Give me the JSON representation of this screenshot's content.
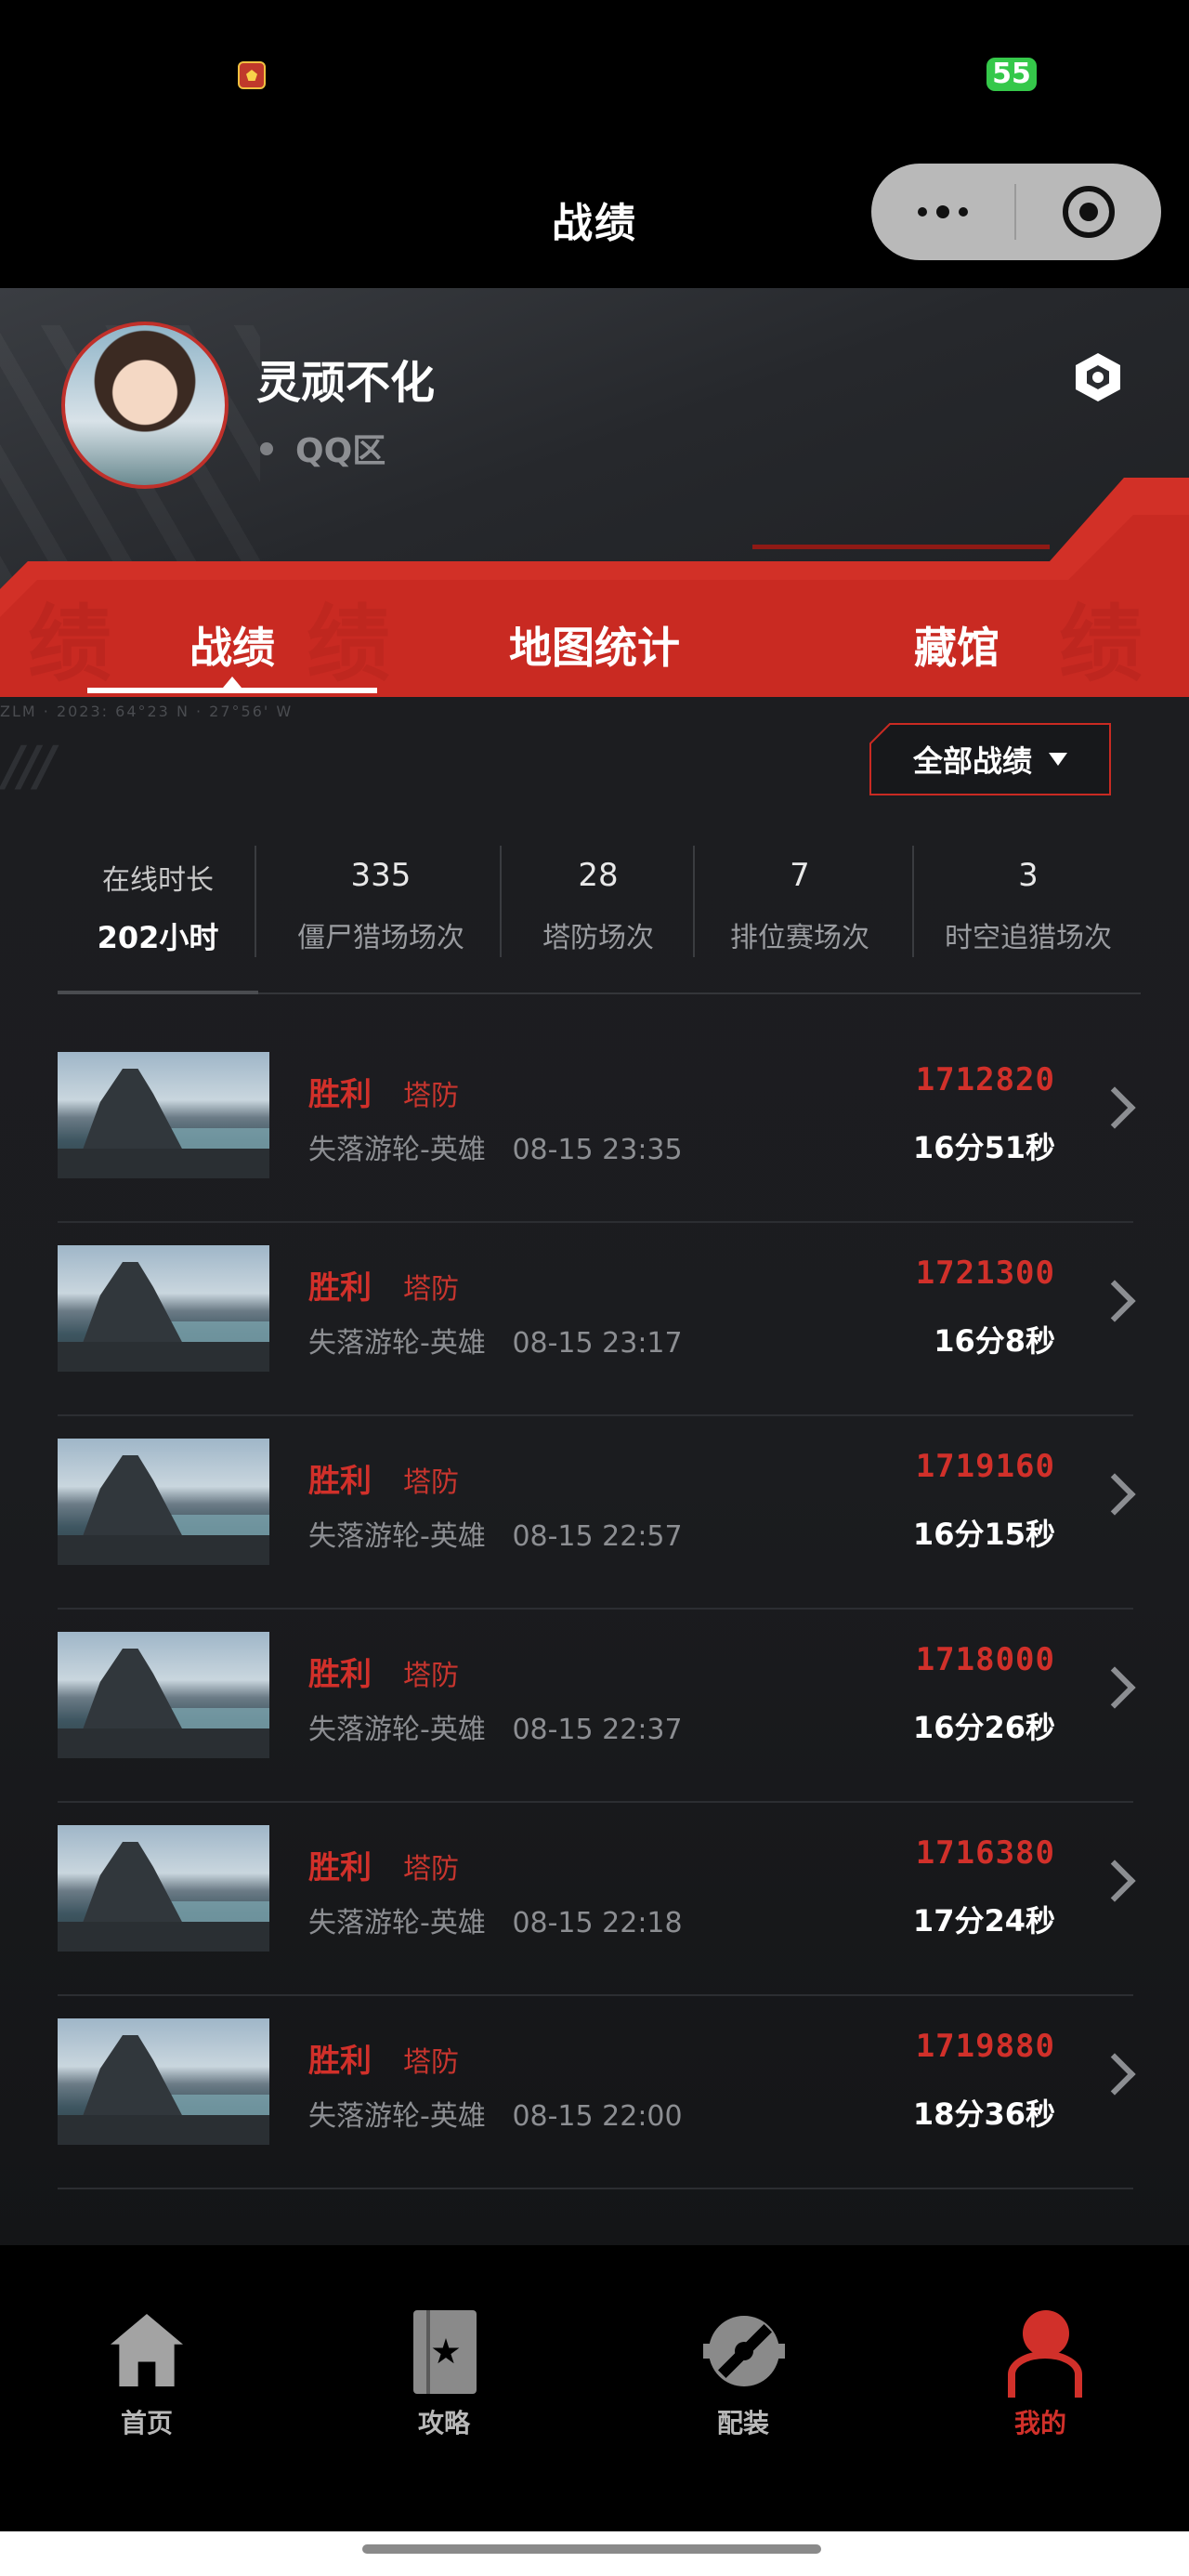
{
  "status": {
    "battery": "55"
  },
  "title": "战绩",
  "profile": {
    "name": "灵顽不化",
    "region": "QQ区"
  },
  "tabs": [
    "战绩",
    "地图统计",
    "藏馆"
  ],
  "deco": {
    "code": "ZLM · 2023: 64°23 N · 27°56' W"
  },
  "filter": {
    "label": "全部战绩"
  },
  "stats": {
    "online_label": "在线时长",
    "online_value": "202小时",
    "items": [
      {
        "value": "335",
        "label": "僵尸猎场场次"
      },
      {
        "value": "28",
        "label": "塔防场次"
      },
      {
        "value": "7",
        "label": "排位赛场次"
      },
      {
        "value": "3",
        "label": "时空追猎场次"
      }
    ]
  },
  "records": [
    {
      "result": "胜利",
      "mode": "塔防",
      "map": "失落游轮-英雄",
      "time": "08-15 23:35",
      "score": "1712820",
      "duration": "16分51秒"
    },
    {
      "result": "胜利",
      "mode": "塔防",
      "map": "失落游轮-英雄",
      "time": "08-15 23:17",
      "score": "1721300",
      "duration": "16分8秒"
    },
    {
      "result": "胜利",
      "mode": "塔防",
      "map": "失落游轮-英雄",
      "time": "08-15 22:57",
      "score": "1719160",
      "duration": "16分15秒"
    },
    {
      "result": "胜利",
      "mode": "塔防",
      "map": "失落游轮-英雄",
      "time": "08-15 22:37",
      "score": "1718000",
      "duration": "16分26秒"
    },
    {
      "result": "胜利",
      "mode": "塔防",
      "map": "失落游轮-英雄",
      "time": "08-15 22:18",
      "score": "1716380",
      "duration": "17分24秒"
    },
    {
      "result": "胜利",
      "mode": "塔防",
      "map": "失落游轮-英雄",
      "time": "08-15 22:00",
      "score": "1719880",
      "duration": "18分36秒"
    }
  ],
  "nav": [
    "首页",
    "攻略",
    "配装",
    "我的"
  ],
  "colors": {
    "accent": "#d1302a",
    "background": "#1c1d20"
  },
  "icons": [
    "home-icon",
    "guide-book-icon",
    "loadout-gear-icon",
    "profile-person-icon"
  ]
}
